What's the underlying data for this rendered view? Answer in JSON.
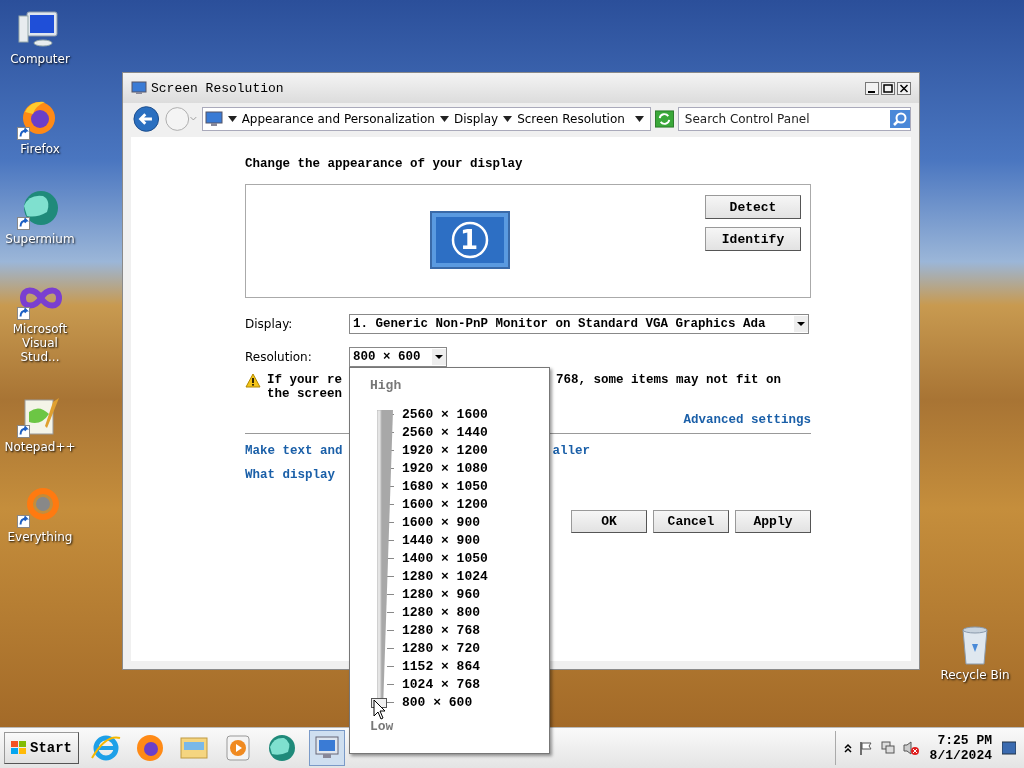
{
  "desktop_icons": [
    {
      "kind": "computer",
      "label": "Computer",
      "shortcut": false
    },
    {
      "kind": "firefox",
      "label": "Firefox",
      "shortcut": true
    },
    {
      "kind": "supermium",
      "label": "Supermium",
      "shortcut": true
    },
    {
      "kind": "infinity",
      "label": "Microsoft Visual Stud...",
      "shortcut": true
    },
    {
      "kind": "notepad",
      "label": "Notepad++",
      "shortcut": true
    },
    {
      "kind": "ring",
      "label": "Everything",
      "shortcut": true
    }
  ],
  "recycle_bin": {
    "label": "Recycle Bin"
  },
  "window": {
    "title": "Screen Resolution",
    "breadcrumb": [
      "Appearance and Personalization",
      "Display",
      "Screen Resolution"
    ],
    "search": {
      "placeholder": "Search Control Panel"
    },
    "heading": "Change the appearance of your display",
    "monitor": {
      "number": "1"
    },
    "side_buttons": [
      "Detect",
      "Identify"
    ],
    "display": {
      "label": "Display:",
      "value": "1. Generic Non-PnP Monitor on Standard VGA Graphics Ada"
    },
    "resolution": {
      "label": "Resolution:",
      "value": "800 × 600"
    },
    "warning": {
      "line1_left": "If your re",
      "line1_right": "768, some items may not fit on",
      "line2": "the screen"
    },
    "advanced_link": "Advanced settings",
    "links": [
      {
        "left": "Make text and",
        "right": "aller"
      },
      {
        "left": "What display"
      }
    ],
    "buttons": [
      "OK",
      "Cancel",
      "Apply"
    ]
  },
  "resolution_menu": {
    "high": "High",
    "low": "Low",
    "level": 0,
    "options": [
      "2560 × 1600",
      "2560 × 1440",
      "1920 × 1200",
      "1920 × 1080",
      "1680 × 1050",
      "1600 × 1200",
      "1600 × 900",
      "1440 × 900",
      "1400 × 1050",
      "1280 × 1024",
      "1280 × 960",
      "1280 × 800",
      "1280 × 768",
      "1280 × 720",
      "1152 × 864",
      "1024 × 768",
      "800 × 600"
    ]
  },
  "taskbar": {
    "start": "Start",
    "apps": [
      {
        "kind": "ie",
        "selected": false
      },
      {
        "kind": "firefox",
        "selected": false
      },
      {
        "kind": "folder",
        "selected": false
      },
      {
        "kind": "media",
        "selected": false
      },
      {
        "kind": "supermium",
        "selected": false
      },
      {
        "kind": "monitor",
        "selected": true
      }
    ],
    "time": "7:25 PM",
    "date": "8/1/2024"
  }
}
